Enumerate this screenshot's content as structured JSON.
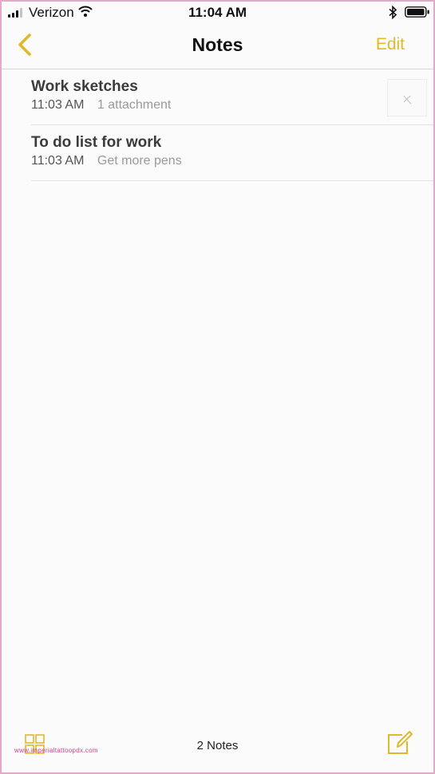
{
  "status_bar": {
    "carrier": "Verizon",
    "time": "11:04 AM"
  },
  "nav": {
    "title": "Notes",
    "edit_label": "Edit"
  },
  "notes": [
    {
      "title": "Work sketches",
      "time": "11:03 AM",
      "detail": "1 attachment",
      "has_thumbnail": true
    },
    {
      "title": "To do list for work",
      "time": "11:03 AM",
      "detail": "Get more pens",
      "has_thumbnail": false
    }
  ],
  "bottom_bar": {
    "count_label": "2 Notes",
    "watermark": "www.imperialtattoopdx.com"
  },
  "icons": [
    "signal-icon",
    "wifi-icon",
    "bluetooth-icon",
    "battery-icon",
    "back-chevron-icon",
    "folders-icon",
    "compose-icon",
    "sketch-thumbnail"
  ],
  "colors": {
    "accent": "#e2b92a",
    "border": "#e3a9c7",
    "watermark": "#d64090"
  }
}
